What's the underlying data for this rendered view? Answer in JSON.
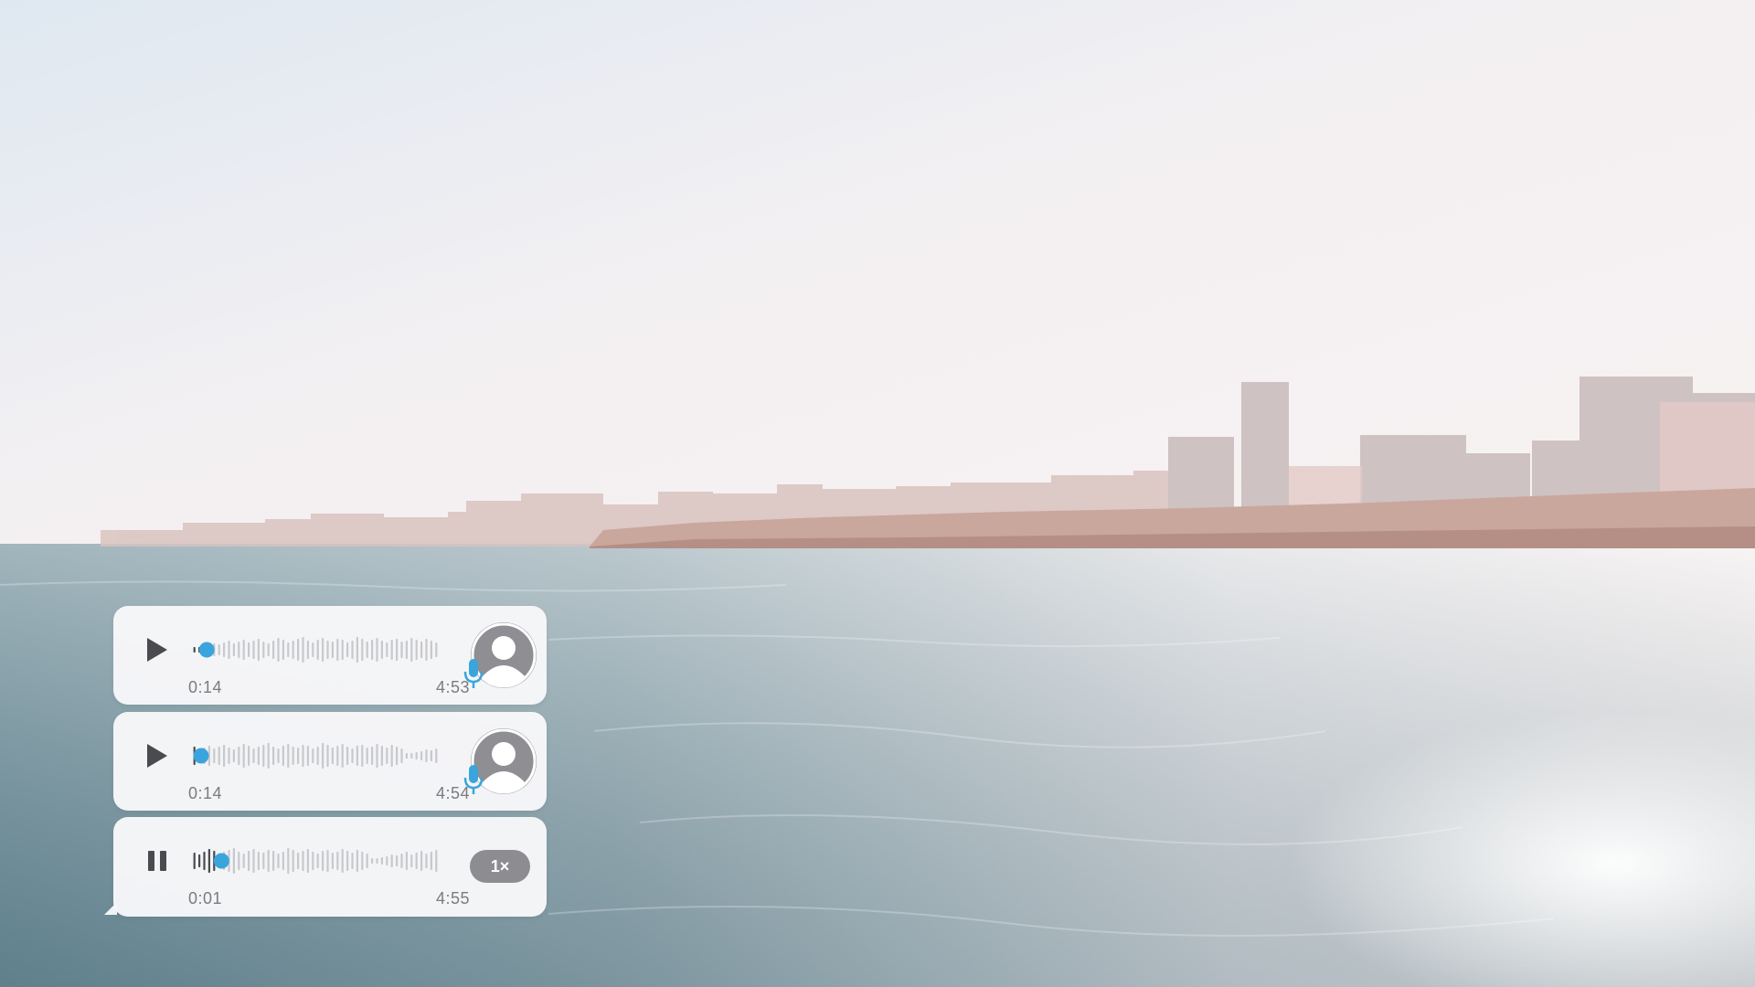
{
  "colors": {
    "accent": "#3aa5dc",
    "bubble": "#f7f7f9",
    "played": "#4a4a4f",
    "unplayed": "#c9c9cd",
    "time_text": "#7b7b80"
  },
  "messages": [
    {
      "id": "voice-message-1",
      "state": "paused",
      "control_icon": "play-icon",
      "current_time": "0:14",
      "duration": "4:53",
      "progress": 0.06,
      "sender": "avatar-placeholder",
      "badge_icon": "microphone-icon"
    },
    {
      "id": "voice-message-2",
      "state": "paused",
      "control_icon": "play-icon",
      "current_time": "0:14",
      "duration": "4:54",
      "progress": 0.0,
      "sender": "avatar-placeholder",
      "badge_icon": "microphone-icon"
    },
    {
      "id": "voice-message-3",
      "state": "playing",
      "control_icon": "pause-icon",
      "current_time": "0:01",
      "duration": "4:55",
      "progress": 0.12,
      "speed_label": "1×"
    }
  ]
}
